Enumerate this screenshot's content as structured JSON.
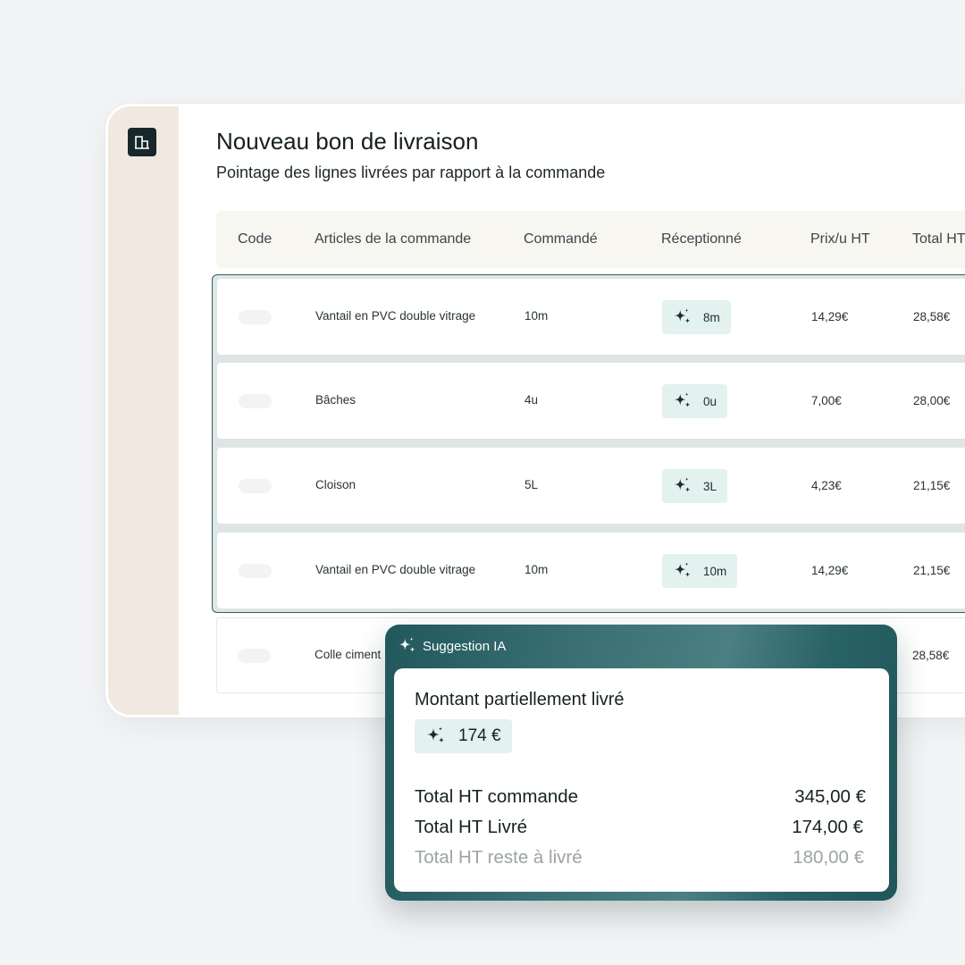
{
  "page": {
    "title": "Nouveau bon de livraison",
    "subtitle": "Pointage des lignes livrées par rapport à la commande"
  },
  "sidebar": {
    "logo_icon": "building-icon"
  },
  "table": {
    "columns": [
      "Code",
      "Articles de la commande",
      "Commandé",
      "Réceptionné",
      "Prix/u HT",
      "Total HT"
    ],
    "rows": [
      {
        "article": "Vantail en PVC double vitrage",
        "ordered": "10m",
        "received": "8m",
        "unit_price": "14,29€",
        "total": "28,58€"
      },
      {
        "article": "Bâches",
        "ordered": "4u",
        "received": "0u",
        "unit_price": "7,00€",
        "total": "28,00€"
      },
      {
        "article": "Cloison",
        "ordered": "5L",
        "received": "3L",
        "unit_price": "4,23€",
        "total": "21,15€"
      },
      {
        "article": "Vantail en PVC double vitrage",
        "ordered": "10m",
        "received": "10m",
        "unit_price": "14,29€",
        "total": "21,15€"
      },
      {
        "article": "Colle ciment",
        "total": "28,58€"
      }
    ]
  },
  "ai_suggestion": {
    "header": "Suggestion IA",
    "title": "Montant partiellement livré",
    "amount": "174 €",
    "summary": [
      {
        "label": "Total HT commande",
        "value": "345,00 €"
      },
      {
        "label": "Total HT Livré",
        "value": "174,00 €"
      },
      {
        "label": "Total HT reste à livré",
        "value": "180,00 €"
      }
    ]
  },
  "colors": {
    "sidebar_bg": "#f1e9df",
    "accent_dark": "#21585b",
    "chip_bg": "#e3f2ef",
    "muted_text": "#9da3a4"
  }
}
